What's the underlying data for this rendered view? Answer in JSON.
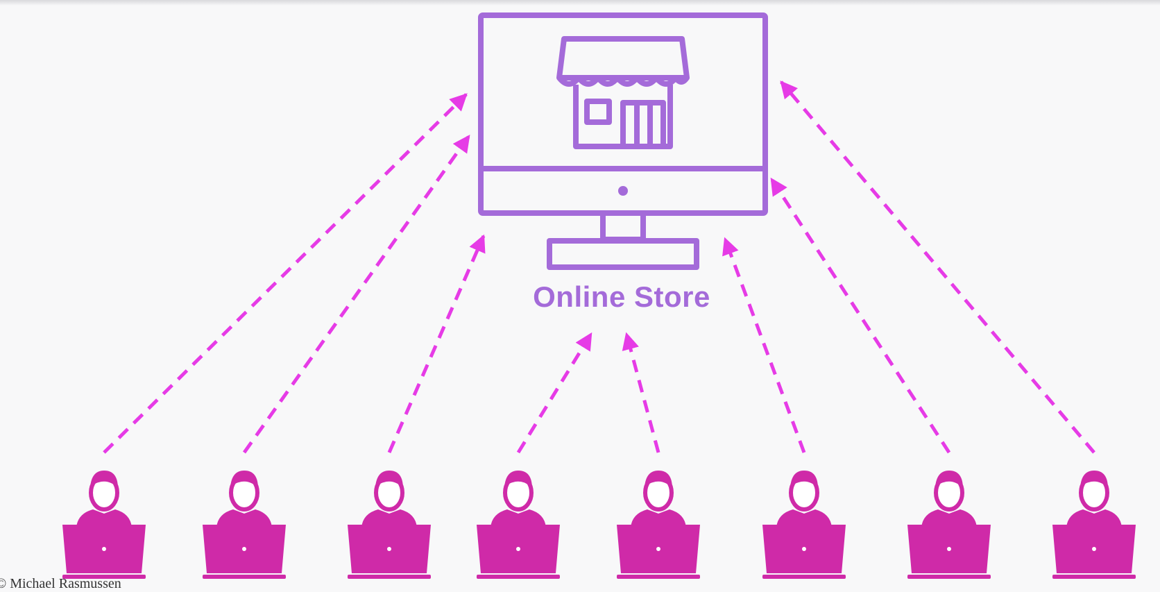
{
  "diagram": {
    "store_label": "Online Store",
    "credit": "© Michael Rasmussen",
    "colors": {
      "background": "#f8f8f9",
      "store": "#a46bd9",
      "customer": "#cf2aa8",
      "arrow": "#e63be6"
    },
    "icons": {
      "store": "monitor-storefront-icon",
      "customer": "person-at-laptop-icon"
    },
    "customer_count": 8
  }
}
